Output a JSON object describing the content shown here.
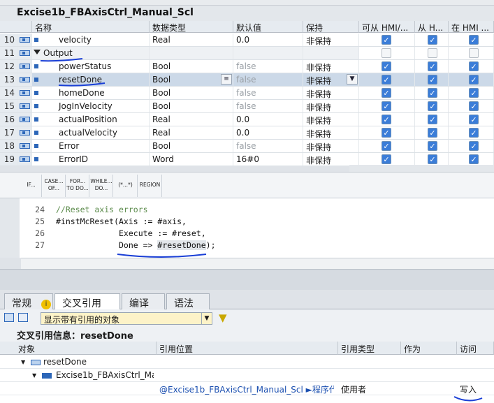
{
  "block": {
    "title": "Excise1b_FBAxisCtrl_Manual_Scl"
  },
  "interface": {
    "headers": {
      "name": "名称",
      "type": "数据类型",
      "default": "默认值",
      "retain": "保持",
      "hmi1": "可从 HMI/...",
      "hmi2": "从 H...",
      "hmi3": "在 HMI ..."
    },
    "rows": [
      {
        "num": "10",
        "name": "velocity",
        "type": "Real",
        "default": "0.0",
        "retain": "非保持",
        "checks": [
          true,
          true,
          true
        ]
      },
      {
        "num": "11",
        "name": "Output",
        "type": "",
        "default": "",
        "retain": "",
        "checks": [
          false,
          false,
          false
        ],
        "section": true
      },
      {
        "num": "12",
        "name": "powerStatus",
        "type": "Bool",
        "default": "false",
        "retain": "非保持",
        "checks": [
          true,
          true,
          true
        ]
      },
      {
        "num": "13",
        "name": "resetDone",
        "type": "Bool",
        "default": "false",
        "retain": "非保持",
        "checks": [
          true,
          true,
          true
        ],
        "selected": true
      },
      {
        "num": "14",
        "name": "homeDone",
        "type": "Bool",
        "default": "false",
        "retain": "非保持",
        "checks": [
          true,
          true,
          true
        ]
      },
      {
        "num": "15",
        "name": "JogInVelocity",
        "type": "Bool",
        "default": "false",
        "retain": "非保持",
        "checks": [
          true,
          true,
          true
        ]
      },
      {
        "num": "16",
        "name": "actualPosition",
        "type": "Real",
        "default": "0.0",
        "retain": "非保持",
        "checks": [
          true,
          true,
          true
        ]
      },
      {
        "num": "17",
        "name": "actualVelocity",
        "type": "Real",
        "default": "0.0",
        "retain": "非保持",
        "checks": [
          true,
          true,
          true
        ]
      },
      {
        "num": "18",
        "name": "Error",
        "type": "Bool",
        "default": "false",
        "retain": "非保持",
        "checks": [
          true,
          true,
          true
        ]
      },
      {
        "num": "19",
        "name": "ErrorID",
        "type": "Word",
        "default": "16#0",
        "retain": "非保持",
        "checks": [
          true,
          true,
          true
        ]
      }
    ]
  },
  "instructions": [
    "IF...",
    "CASE... OF...",
    "FOR... TO DO...",
    "WHILE... DO...",
    "(*...*)",
    "REGION"
  ],
  "code": {
    "lines": [
      {
        "num": "24",
        "text": "//Reset axis errors",
        "comment": true
      },
      {
        "num": "25",
        "text": "#instMcReset(Axis := #axis,"
      },
      {
        "num": "26",
        "text": "             Execute := #reset,"
      },
      {
        "num": "27",
        "text_a": "             Done => ",
        "text_b": "#resetDone",
        "text_c": ");"
      }
    ]
  },
  "inspector": {
    "tabs": [
      "常规",
      "交叉引用",
      "编译",
      "语法"
    ],
    "filter_value": "显示带有引用的对象",
    "info_title": "交叉引用信息：resetDone",
    "columns": {
      "object": "对象",
      "location": "引用位置",
      "ref_type": "引用类型",
      "as": "作为",
      "access": "访问"
    },
    "rows": [
      {
        "object": "resetDone"
      },
      {
        "object": "Excise1b_FBAxisCtrl_Ma..."
      },
      {
        "location": "@Excise1b_FBAxisCtrl_Manual_Scl ►程序代...",
        "ref_type": "使用者",
        "access": "写入"
      }
    ]
  },
  "colors": {
    "accent": "#3b7dd8",
    "selection": "#ccd9e8",
    "annotation": "#1a3fd6"
  }
}
